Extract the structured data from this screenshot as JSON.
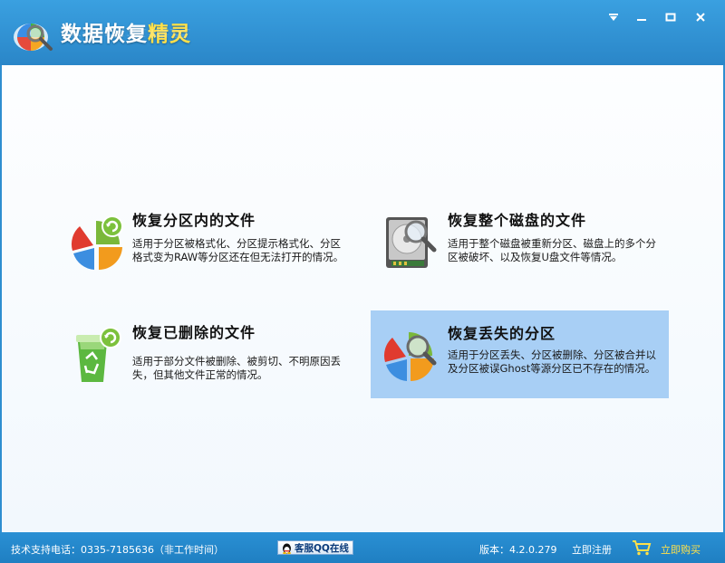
{
  "app": {
    "title_main": "数据恢复",
    "title_accent": "精灵",
    "title_full": "数据恢复精灵"
  },
  "window_controls": {
    "menu_icon": "menu-down-icon",
    "minimize_icon": "minimize-icon",
    "maximize_icon": "maximize-icon",
    "close_icon": "close-icon"
  },
  "options": [
    {
      "title": "恢复分区内的文件",
      "desc": "适用于分区被格式化、分区提示格式化、分区格式变为RAW等分区还在但无法打开的情况。",
      "icon": "pie-chart-refresh-icon"
    },
    {
      "title": "恢复整个磁盘的文件",
      "desc": "适用于整个磁盘被重新分区、磁盘上的多个分区被破坏、以及恢复U盘文件等情况。",
      "icon": "hard-disk-search-icon"
    },
    {
      "title": "恢复已删除的文件",
      "desc": "适用于部分文件被删除、被剪切、不明原因丢失，但其他文件正常的情况。",
      "icon": "recycle-bin-refresh-icon"
    },
    {
      "title": "恢复丢失的分区",
      "desc": "适用于分区丢失、分区被删除、分区被合并以及分区被误Ghost等源分区已不存在的情况。",
      "icon": "pie-chart-search-icon",
      "selected": true
    }
  ],
  "status": {
    "support": "技术支持电话：0335-7185636（非工作时间）",
    "qq_button": "客服QQ在线",
    "version": "版本：4.2.0.279",
    "register": "立即注册",
    "buy": "立即购买"
  },
  "colors": {
    "titlebar": "#2a8fd2",
    "selected_card": "#a8cff5",
    "accent_yellow": "#ffe04a"
  }
}
